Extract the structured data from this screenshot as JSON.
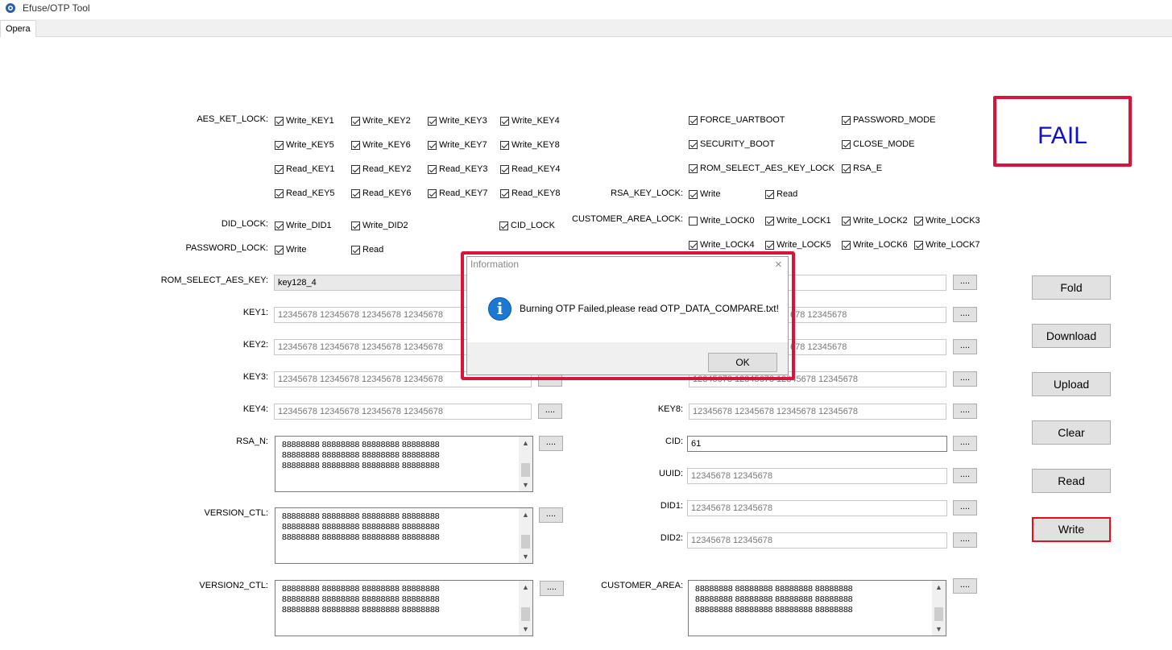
{
  "window": {
    "title": "Efuse/OTP Tool"
  },
  "tabs": [
    {
      "label": "Opera"
    }
  ],
  "status": {
    "text": "FAIL",
    "color": "#1010c8"
  },
  "left": {
    "aes_key_lock_label": "AES_KET_LOCK:",
    "aes_key_lock": [
      {
        "label": "Write_KEY1",
        "checked": true
      },
      {
        "label": "Write_KEY2",
        "checked": true
      },
      {
        "label": "Write_KEY3",
        "checked": true
      },
      {
        "label": "Write_KEY4",
        "checked": true
      },
      {
        "label": "Write_KEY5",
        "checked": true
      },
      {
        "label": "Write_KEY6",
        "checked": true
      },
      {
        "label": "Write_KEY7",
        "checked": true
      },
      {
        "label": "Write_KEY8",
        "checked": true
      },
      {
        "label": "Read_KEY1",
        "checked": true
      },
      {
        "label": "Read_KEY2",
        "checked": true
      },
      {
        "label": "Read_KEY3",
        "checked": true
      },
      {
        "label": "Read_KEY4",
        "checked": true
      },
      {
        "label": "Read_KEY5",
        "checked": true
      },
      {
        "label": "Read_KEY6",
        "checked": true
      },
      {
        "label": "Read_KEY7",
        "checked": true
      },
      {
        "label": "Read_KEY8",
        "checked": true
      }
    ],
    "did_lock_label": "DID_LOCK:",
    "did_lock": [
      {
        "label": "Write_DID1",
        "checked": true
      },
      {
        "label": "Write_DID2",
        "checked": true
      }
    ],
    "cid_lock": {
      "label": "CID_LOCK",
      "checked": true
    },
    "password_lock_label": "PASSWORD_LOCK:",
    "password_lock": [
      {
        "label": "Write",
        "checked": true
      },
      {
        "label": "Read",
        "checked": true
      }
    ],
    "rom_select_label": "ROM_SELECT_AES_KEY:",
    "rom_select_value": "key128_4",
    "keys": [
      {
        "label": "KEY1:",
        "value": "12345678 12345678 12345678 12345678"
      },
      {
        "label": "KEY2:",
        "value": "12345678 12345678 12345678 12345678"
      },
      {
        "label": "KEY3:",
        "value": "12345678 12345678 12345678 12345678"
      },
      {
        "label": "KEY4:",
        "value": "12345678 12345678 12345678 12345678"
      }
    ],
    "rsa_n": {
      "label": "RSA_N:",
      "lines": "88888888 88888888 88888888 88888888\n88888888 88888888 88888888 88888888\n88888888 88888888 88888888 88888888"
    },
    "version_ctl": {
      "label": "VERSION_CTL:",
      "lines": "88888888 88888888 88888888 88888888\n88888888 88888888 88888888 88888888\n88888888 88888888 88888888 88888888"
    },
    "version2_ctl": {
      "label": "VERSION2_CTL:",
      "lines": "88888888 88888888 88888888 88888888\n88888888 88888888 88888888 88888888\n88888888 88888888 88888888 88888888"
    }
  },
  "right": {
    "flags": [
      {
        "label": "FORCE_UARTBOOT",
        "checked": true
      },
      {
        "label": "PASSWORD_MODE",
        "checked": true
      },
      {
        "label": "SECURITY_BOOT",
        "checked": true
      },
      {
        "label": "CLOSE_MODE",
        "checked": true
      },
      {
        "label": "ROM_SELECT_AES_KEY_LOCK",
        "checked": true
      },
      {
        "label": "RSA_E",
        "checked": true
      }
    ],
    "rsa_key_lock_label": "RSA_KEY_LOCK:",
    "rsa_key_lock": [
      {
        "label": "Write",
        "checked": true
      },
      {
        "label": "Read",
        "checked": true
      }
    ],
    "customer_area_lock_label": "CUSTOMER_AREA_LOCK:",
    "customer_area_lock": [
      {
        "label": "Write_LOCK0",
        "checked": false
      },
      {
        "label": "Write_LOCK1",
        "checked": true
      },
      {
        "label": "Write_LOCK2",
        "checked": true
      },
      {
        "label": "Write_LOCK3",
        "checked": true
      },
      {
        "label": "Write_LOCK4",
        "checked": true
      },
      {
        "label": "Write_LOCK5",
        "checked": true
      },
      {
        "label": "Write_LOCK6",
        "checked": true
      },
      {
        "label": "Write_LOCK7",
        "checked": true
      }
    ],
    "key_partial": [
      "",
      "678 12345678",
      "678 12345678",
      "12345678 12345678 12345678 12345678"
    ],
    "key8": {
      "label": "KEY8:",
      "value": "12345678 12345678 12345678 12345678"
    },
    "cid": {
      "label": "CID:",
      "value": "61"
    },
    "uuid": {
      "label": "UUID:",
      "value": "12345678 12345678"
    },
    "did1": {
      "label": "DID1:",
      "value": "12345678 12345678"
    },
    "did2": {
      "label": "DID2:",
      "value": "12345678 12345678"
    },
    "customer_area": {
      "label": "CUSTOMER_AREA:",
      "lines": "88888888 88888888 88888888 88888888\n88888888 88888888 88888888 88888888\n88888888 88888888 88888888 88888888"
    }
  },
  "browse_label": "....",
  "actions": {
    "fold": "Fold",
    "download": "Download",
    "upload": "Upload",
    "clear": "Clear",
    "read": "Read",
    "write": "Write"
  },
  "dialog": {
    "title": "Information",
    "message": "Burning OTP Failed,please read OTP_DATA_COMPARE.txt!",
    "ok": "OK",
    "icon": "info-icon",
    "close_glyph": "×",
    "info_glyph": "i"
  }
}
